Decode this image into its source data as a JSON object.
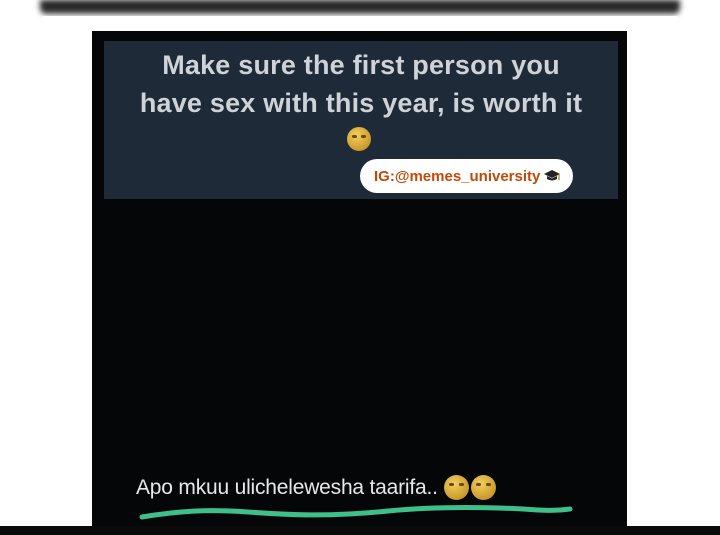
{
  "meme": {
    "caption_line1": "Make sure the first person you",
    "caption_line2": "have sex with this year, is worth it",
    "caption_emoji": "grimacing-emoji",
    "watermark": "IG:@memes_university",
    "watermark_icon": "graduation-cap-icon",
    "subtitle": "Apo mkuu ulichelewesha taarifa..",
    "subtitle_emojis": [
      "laughing-emoji",
      "laughing-emoji"
    ],
    "underline_color": "#3fbf8a",
    "caption_bg": "#1e2a38",
    "watermark_color": "#c24a08"
  }
}
